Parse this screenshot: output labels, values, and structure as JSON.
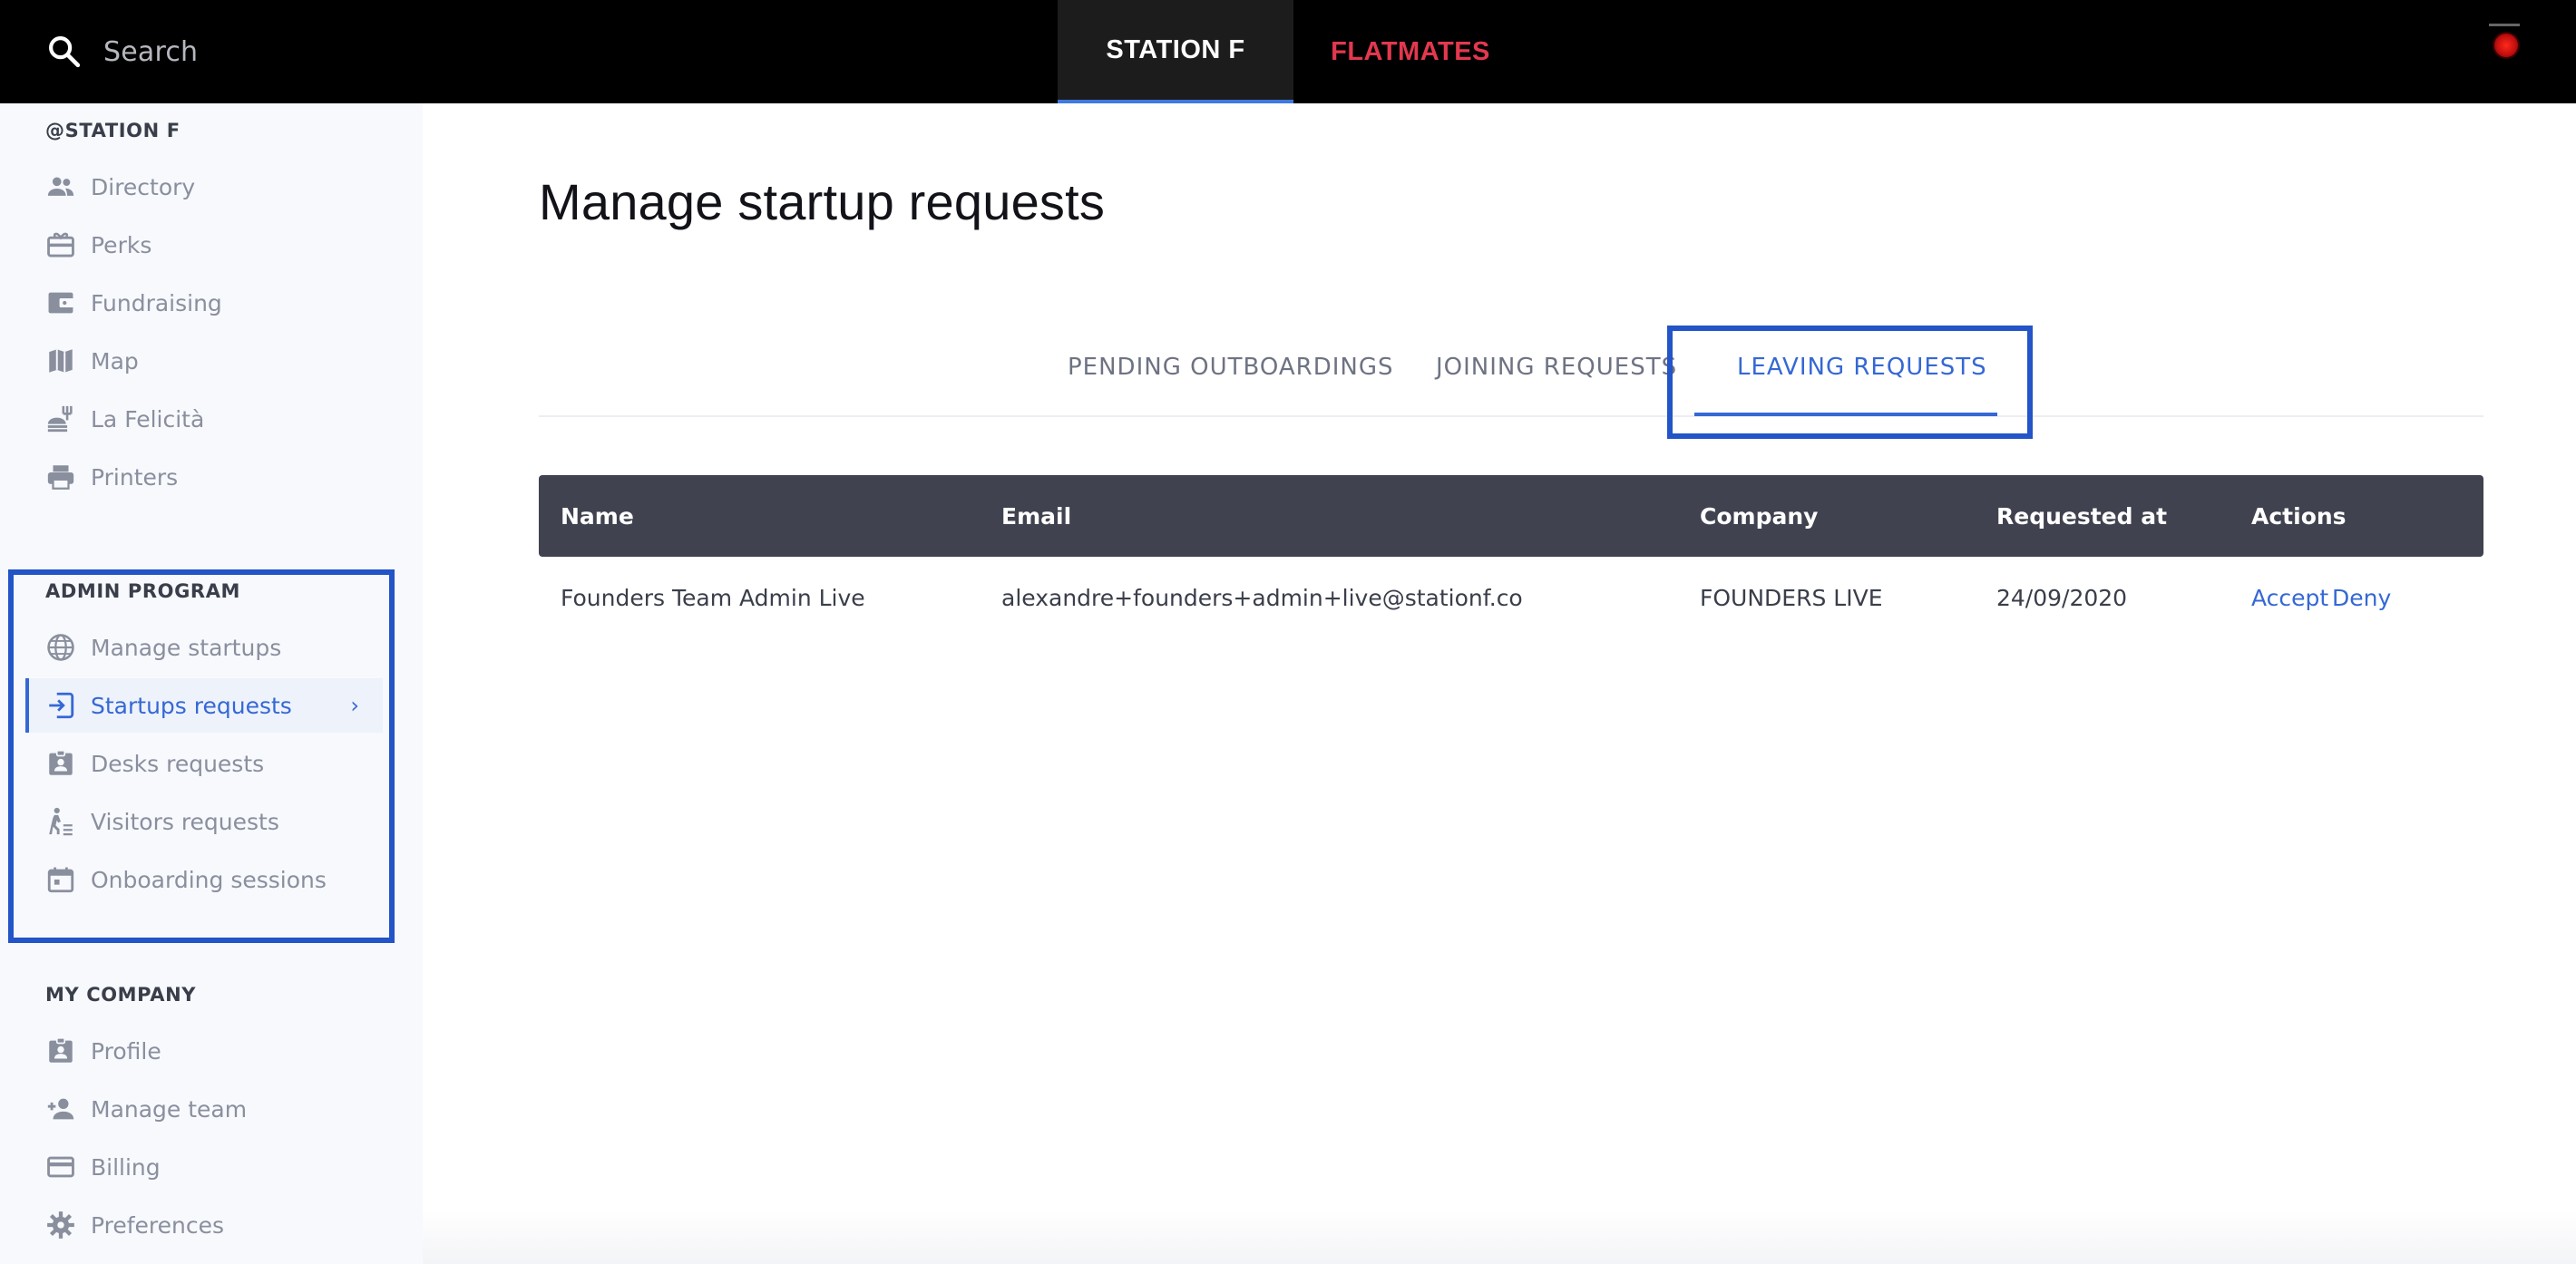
{
  "topbar": {
    "search_placeholder": "Search",
    "tabs": [
      {
        "label": "STATION F",
        "active": true
      },
      {
        "label": "FLATMATES",
        "color": "#e2384f"
      }
    ]
  },
  "sidebar": {
    "station_title": "@STATION F",
    "station_items": [
      {
        "label": "Directory",
        "icon": "people-icon"
      },
      {
        "label": "Perks",
        "icon": "gift-card-icon"
      },
      {
        "label": "Fundraising",
        "icon": "wallet-icon"
      },
      {
        "label": "Map",
        "icon": "map-icon"
      },
      {
        "label": "La Felicità",
        "icon": "food-icon"
      },
      {
        "label": "Printers",
        "icon": "printer-icon"
      }
    ],
    "admin_title": "ADMIN PROGRAM",
    "admin_items": [
      {
        "label": "Manage startups",
        "icon": "globe-icon"
      },
      {
        "label": "Startups requests",
        "icon": "enter-icon",
        "active": true
      },
      {
        "label": "Desks requests",
        "icon": "badge-icon"
      },
      {
        "label": "Visitors requests",
        "icon": "visitor-icon"
      },
      {
        "label": "Onboarding sessions",
        "icon": "calendar-icon"
      }
    ],
    "company_title": "MY COMPANY",
    "company_items": [
      {
        "label": "Profile",
        "icon": "badge-icon"
      },
      {
        "label": "Manage team",
        "icon": "add-person-icon"
      },
      {
        "label": "Billing",
        "icon": "credit-card-icon"
      },
      {
        "label": "Preferences",
        "icon": "gear-icon"
      }
    ]
  },
  "main": {
    "title": "Manage startup requests",
    "tabs": [
      {
        "label": "PENDING OUTBOARDINGS"
      },
      {
        "label": "JOINING REQUESTS"
      },
      {
        "label": "LEAVING REQUESTS",
        "active": true
      }
    ],
    "table": {
      "columns": [
        "Name",
        "Email",
        "Company",
        "Requested at",
        "Actions"
      ],
      "rows": [
        {
          "name": "Founders Team Admin Live",
          "email": "alexandre+founders+admin+live@stationf.co",
          "company": "FOUNDERS LIVE",
          "requested_at": "24/09/2020",
          "accept_label": "Accept",
          "deny_label": "Deny"
        }
      ]
    }
  },
  "colors": {
    "accent": "#3568d4",
    "highlight_frame": "#2354c8",
    "flatmates": "#e2384f",
    "table_header": "#40424f"
  }
}
